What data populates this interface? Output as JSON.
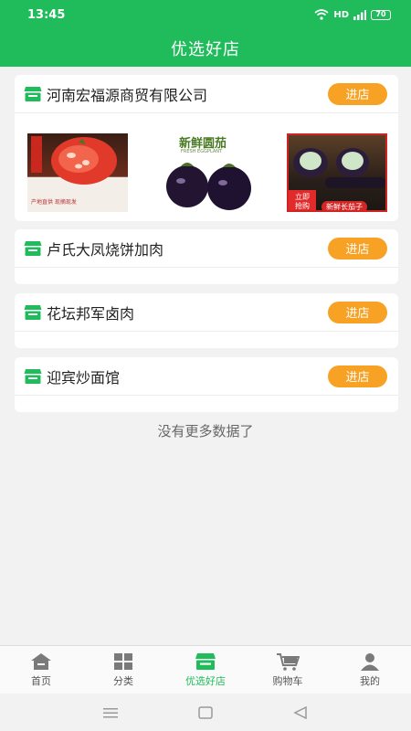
{
  "status_bar": {
    "time": "13:45",
    "network": "HD",
    "battery": "70"
  },
  "header": {
    "title": "优选好店"
  },
  "stores": [
    {
      "name": "河南宏福源商贸有限公司",
      "button": "进店",
      "products": [
        {
          "caption_lines": [
            "产地直供 现摘现发"
          ]
        },
        {
          "title": "新鲜圆茄",
          "subtitle": "FRESH EGGPLANT"
        },
        {
          "badge_lines": [
            "立即",
            "抢购"
          ],
          "tag": "新鲜长茄子"
        }
      ]
    },
    {
      "name": "卢氏大凤烧饼加肉",
      "button": "进店"
    },
    {
      "name": "花坛邦军卤肉",
      "button": "进店"
    },
    {
      "name": "迎宾炒面馆",
      "button": "进店"
    }
  ],
  "footer_text": "没有更多数据了",
  "tabs": [
    {
      "label": "首页",
      "icon": "home-icon"
    },
    {
      "label": "分类",
      "icon": "grid-icon"
    },
    {
      "label": "优选好店",
      "icon": "store-icon",
      "active": true
    },
    {
      "label": "购物车",
      "icon": "cart-icon"
    },
    {
      "label": "我的",
      "icon": "user-icon"
    }
  ],
  "colors": {
    "primary": "#20bc5c",
    "accent": "#f7a224"
  }
}
